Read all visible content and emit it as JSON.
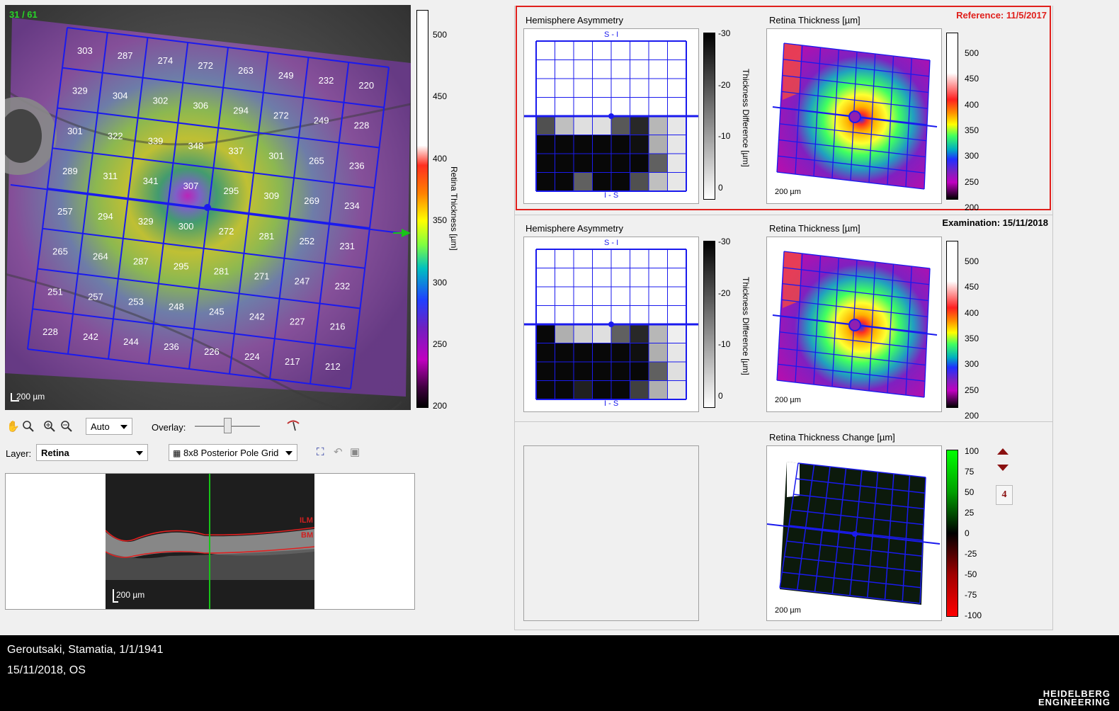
{
  "fundus": {
    "frame_counter": "31 / 61",
    "scale_label": "200 µm",
    "grid_values": [
      [
        303,
        287,
        274,
        272,
        263,
        249,
        232,
        220
      ],
      [
        329,
        304,
        302,
        306,
        294,
        272,
        249,
        228
      ],
      [
        301,
        322,
        339,
        348,
        337,
        301,
        265,
        236
      ],
      [
        289,
        311,
        341,
        307,
        295,
        309,
        269,
        234
      ],
      [
        257,
        294,
        329,
        300,
        272,
        281,
        252,
        231
      ],
      [
        265,
        264,
        287,
        295,
        281,
        271,
        247,
        232
      ],
      [
        251,
        257,
        253,
        248,
        245,
        242,
        227,
        216
      ],
      [
        228,
        242,
        244,
        236,
        226,
        224,
        217,
        212
      ]
    ],
    "colorbar": {
      "title": "Retina Thickness [µm]",
      "ticks": [
        "500",
        "450",
        "400",
        "350",
        "300",
        "250",
        "200"
      ]
    }
  },
  "toolbar": {
    "zoom_mode": "Auto",
    "overlay_label": "Overlay:",
    "overlay_value": 0.5,
    "layer_label": "Layer:",
    "layer_value": "Retina",
    "grid_value": "8x8 Posterior Pole Grid"
  },
  "bscan": {
    "scale_label": "200 µm",
    "ilm_label": "ILM",
    "bm_label": "BM"
  },
  "reference": {
    "header": "Reference: 11/5/2017",
    "asym_title": "Hemisphere Asymmetry",
    "asym_top": "S - I",
    "asym_bottom": "I - S",
    "asym_bar_title": "Thickness Difference [µm]",
    "asym_bar_ticks": [
      "-30",
      "-20",
      "-10",
      "0"
    ],
    "thick_title": "Retina Thickness [µm]",
    "thick_scale": "200 µm",
    "thick_ticks": [
      "500",
      "450",
      "400",
      "350",
      "300",
      "250",
      "200"
    ],
    "asym_grey": [
      [
        -22,
        -8,
        -4,
        -4,
        -21,
        -27,
        -9,
        -3
      ],
      [
        -31,
        -31,
        -31,
        -31,
        -31,
        -30,
        -10,
        -3
      ],
      [
        -31,
        -31,
        -31,
        -31,
        -31,
        -31,
        -20,
        -3
      ],
      [
        -31,
        -31,
        -20,
        -31,
        -31,
        -22,
        -8,
        -3
      ]
    ]
  },
  "examination": {
    "header": "Examination: 15/11/2018",
    "asym_title": "Hemisphere Asymmetry",
    "asym_top": "S - I",
    "asym_bottom": "I - S",
    "asym_bar_title": "Thickness Difference [µm]",
    "asym_bar_ticks": [
      "-30",
      "-20",
      "-10",
      "0"
    ],
    "thick_title": "Retina Thickness [µm]",
    "thick_scale": "200 µm",
    "thick_ticks": [
      "500",
      "450",
      "400",
      "350",
      "300",
      "250",
      "200"
    ],
    "asym_grey": [
      [
        -31,
        -10,
        -6,
        -4,
        -20,
        -27,
        -9,
        -2
      ],
      [
        -31,
        -31,
        -31,
        -31,
        -31,
        -30,
        -10,
        -3
      ],
      [
        -31,
        -31,
        -31,
        -31,
        -31,
        -31,
        -20,
        -4
      ],
      [
        -31,
        -31,
        -28,
        -31,
        -31,
        -24,
        -10,
        -3
      ]
    ]
  },
  "change": {
    "title": "Retina Thickness Change [µm]",
    "scale": "200 µm",
    "ticks": [
      "100",
      "75",
      "50",
      "25",
      "0",
      "-25",
      "-50",
      "-75",
      "-100"
    ],
    "spinner_value": "4"
  },
  "patient": {
    "name_line": "Geroutsaki, Stamatia, 1/1/1941",
    "exam_line": "15/11/2018, OS",
    "brand_line1": "HEIDELBERG",
    "brand_line2": "ENGINEERING"
  },
  "colors": {
    "reference_border": "#e0201c",
    "grid": "#1010e0",
    "marker": "#18c418"
  }
}
